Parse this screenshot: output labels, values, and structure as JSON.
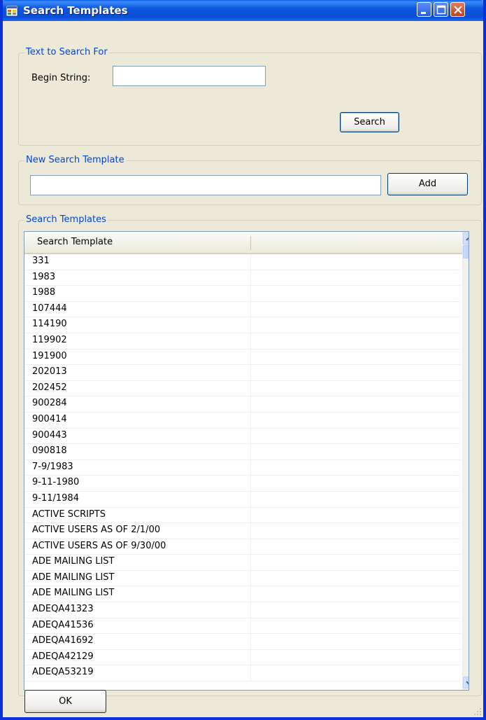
{
  "window": {
    "title": "Search Templates"
  },
  "text_search_group": {
    "label": "Text to Search For",
    "begin_label": "Begin String:",
    "begin_value": "",
    "search_button": "Search"
  },
  "new_template_group": {
    "label": "New Search Template",
    "input_value": "",
    "add_button": "Add"
  },
  "templates_group": {
    "label": "Search Templates",
    "column_header": "Search Template",
    "rows": [
      "331",
      "1983",
      "1988",
      "107444",
      "114190",
      "119902",
      "191900",
      "202013",
      "202452",
      "900284",
      "900414",
      "900443",
      "090818",
      "7-9/1983",
      "9-11-1980",
      "9-11/1984",
      "ACTIVE SCRIPTS",
      "ACTIVE USERS AS OF 2/1/00",
      "ACTIVE USERS AS OF 9/30/00",
      "ADE MAILING LIST",
      "ADE MAILING LIST",
      "ADE MAILING LIST",
      "ADEQA41323",
      "ADEQA41536",
      "ADEQA41692",
      "ADEQA42129",
      "ADEQA53219"
    ]
  },
  "footer": {
    "ok_button": "OK"
  },
  "colors": {
    "titlebar": "#0a5ee8",
    "group_label": "#0046d5",
    "window_bg": "#ece9d8"
  }
}
